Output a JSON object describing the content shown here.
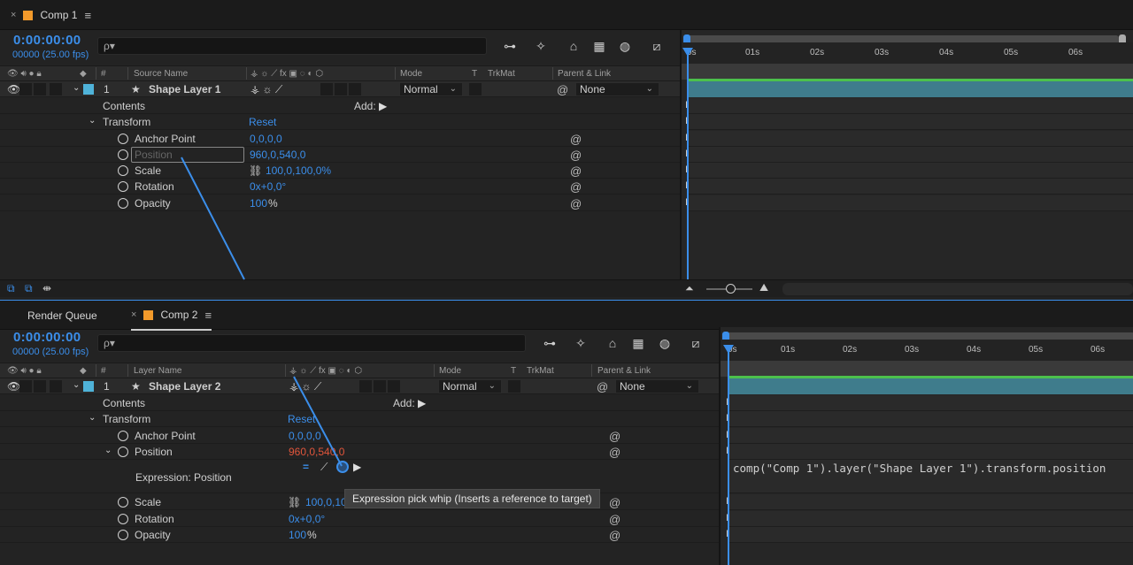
{
  "comp1": {
    "tab": {
      "close": "×",
      "label": "Comp 1",
      "menu": "≡"
    },
    "timecode": "0:00:00:00",
    "fps": "00000 (25.00 fps)",
    "search_placeholder": "ρ▾",
    "columns": {
      "num": "#",
      "source": "Source Name",
      "switches": "⚶ ☼ ⟋ fx ▣ ◌ ◐ ⬡",
      "mode": "Mode",
      "t": "T",
      "trkmat": "TrkMat",
      "parent": "Parent & Link"
    },
    "layer": {
      "index": "1",
      "name": "Shape Layer 1",
      "mode": "Normal",
      "parent": "None"
    },
    "contents": "Contents",
    "add": "Add:",
    "transform": "Transform",
    "reset": "Reset",
    "props": [
      {
        "name": "Anchor Point",
        "value": "0,0,0,0"
      },
      {
        "name": "Position",
        "value": "960,0,540,0"
      },
      {
        "name": "Scale",
        "value": "100,0,100,0%"
      },
      {
        "name": "Rotation",
        "value": "0x+0,0°"
      },
      {
        "name": "Opacity",
        "value": "100",
        "unit": "%"
      }
    ],
    "ruler": [
      "0s",
      "01s",
      "02s",
      "03s",
      "04s",
      "05s",
      "06s"
    ]
  },
  "comp2": {
    "render_queue": "Render Queue",
    "tab": {
      "close": "×",
      "label": "Comp 2",
      "menu": "≡"
    },
    "timecode": "0:00:00:00",
    "fps": "00000 (25.00 fps)",
    "search_placeholder": "ρ▾",
    "columns": {
      "num": "#",
      "source": "Layer Name",
      "mode": "Mode",
      "t": "T",
      "trkmat": "TrkMat",
      "parent": "Parent & Link"
    },
    "layer": {
      "index": "1",
      "name": "Shape Layer 2",
      "mode": "Normal",
      "parent": "None"
    },
    "contents": "Contents",
    "add": "Add:",
    "transform": "Transform",
    "reset": "Reset",
    "anchor": {
      "name": "Anchor Point",
      "value": "0,0,0,0"
    },
    "position": {
      "name": "Position",
      "value": "960,0,540,0"
    },
    "expression_label": "Expression: Position",
    "expression_text": "comp(\"Comp 1\").layer(\"Shape Layer 1\").transform.position",
    "tooltip": "Expression pick whip (Inserts a reference to target)",
    "scale": {
      "name": "Scale",
      "value": "100,0,10"
    },
    "rotation": {
      "name": "Rotation",
      "value": "0x+0,0°"
    },
    "opacity": {
      "name": "Opacity",
      "value": "100",
      "unit": "%"
    },
    "ruler": [
      "0s",
      "01s",
      "02s",
      "03s",
      "04s",
      "05s",
      "06s"
    ]
  },
  "colors": {
    "accent": "#3b8eea",
    "layer_bar": "#3f7c8c",
    "label_swatch": "#4fb3d9",
    "comp_tab": "#f39a2b",
    "red_value": "#e0553b"
  }
}
